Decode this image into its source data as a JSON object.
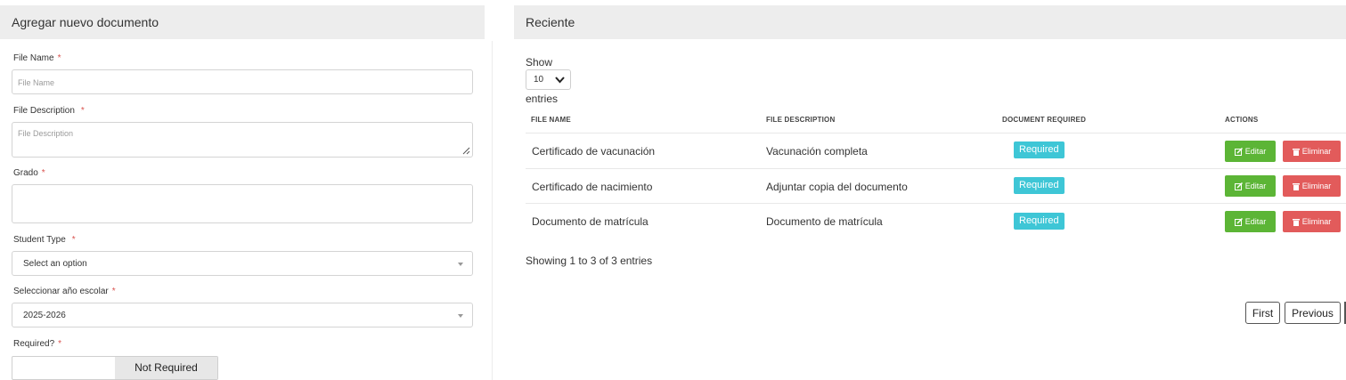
{
  "left_panel": {
    "title": "Agregar nuevo documento",
    "file_name": {
      "label": "File Name",
      "placeholder": "File Name"
    },
    "file_description": {
      "label": "File Description",
      "placeholder": "File Description"
    },
    "grado": {
      "label": "Grado"
    },
    "student_type": {
      "label": "Student Type",
      "value": "Select an option"
    },
    "school_year": {
      "label": "Seleccionar año escolar",
      "value": "2025-2026"
    },
    "required": {
      "label": "Required?",
      "toggle_label": "Not Required"
    },
    "required_marker": "*"
  },
  "right_panel": {
    "title": "Reciente",
    "show_label": "Show",
    "entries_value": "10",
    "entries_label": "entries",
    "columns": [
      "FILE NAME",
      "FILE DESCRIPTION",
      "DOCUMENT REQUIRED",
      "ACTIONS"
    ],
    "rows": [
      {
        "file_name": "Certificado de vacunación",
        "description": "Vacunación completa",
        "required": "Required"
      },
      {
        "file_name": "Certificado de nacimiento",
        "description": "Adjuntar copia del documento",
        "required": "Required"
      },
      {
        "file_name": "Documento de matrícula",
        "description": "Documento de matrícula",
        "required": "Required"
      }
    ],
    "edit_label": "Editar",
    "delete_label": "Eliminar",
    "info": "Showing 1 to 3 of 3 entries",
    "pagination": {
      "first": "First",
      "previous": "Previous"
    }
  },
  "colors": {
    "badge": "#3ec6d6",
    "edit_button": "#5cb536",
    "delete_button": "#e25b5b",
    "header_bg": "#ededed"
  },
  "icons": [
    "edit-icon",
    "trash-icon",
    "chevron-down-icon",
    "resize-handle-icon"
  ]
}
